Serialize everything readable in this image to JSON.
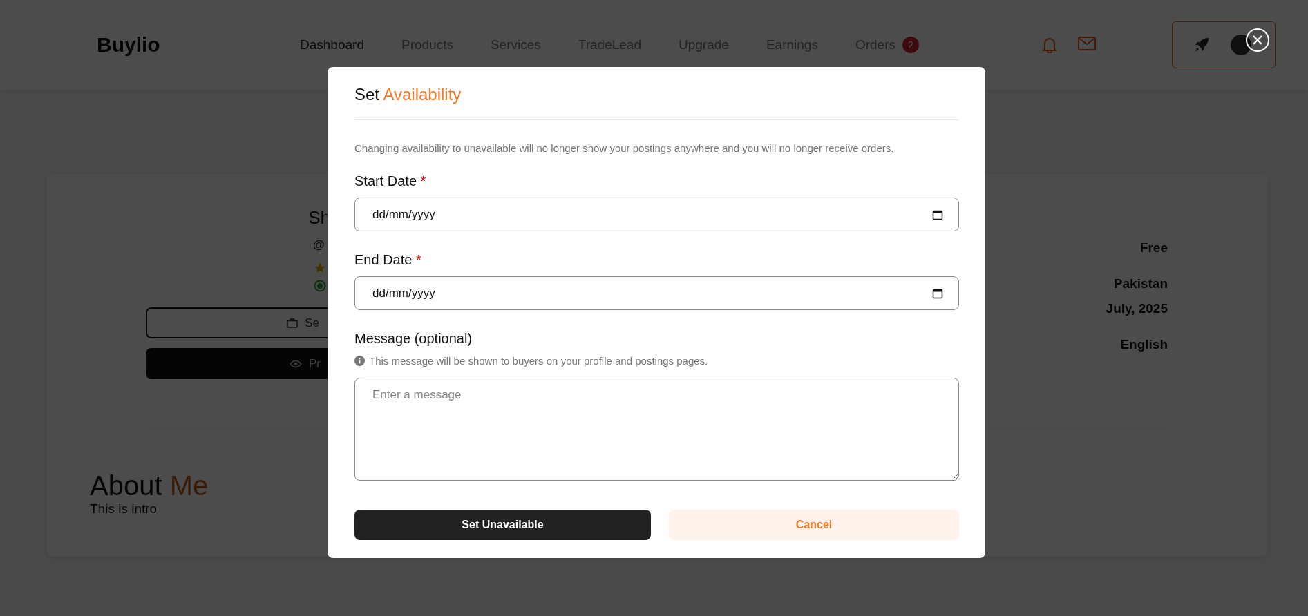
{
  "header": {
    "logo": "Buylio",
    "nav": [
      {
        "label": "Dashboard",
        "selected": true
      },
      {
        "label": "Products",
        "selected": false
      },
      {
        "label": "Services",
        "selected": false
      },
      {
        "label": "TradeLead",
        "selected": false
      },
      {
        "label": "Upgrade",
        "selected": false
      },
      {
        "label": "Earnings",
        "selected": false
      },
      {
        "label": "Orders",
        "selected": false,
        "badge": "2"
      }
    ]
  },
  "profile": {
    "name": "Sh",
    "handle": "@",
    "buttons": [
      {
        "label": "Se",
        "kind": "outline"
      },
      {
        "label": "Pr",
        "kind": "dark"
      }
    ]
  },
  "details": [
    "Free",
    "Pakistan",
    "July, 2025",
    "English"
  ],
  "about": {
    "title": "About",
    "title_accent": "Me",
    "text": "This is intro"
  },
  "modal": {
    "title": "Set",
    "title_accent": "Availability",
    "notice": "Changing availability to unavailable will no longer show your postings anywhere and you will no longer receive orders.",
    "fields": [
      {
        "label": "Start Date",
        "required_mark": "*",
        "placeholder": "dd/mm/yyyy"
      },
      {
        "label": "End Date",
        "required_mark": "*",
        "placeholder": "dd/mm/yyyy"
      }
    ],
    "message": {
      "label": "Message (optional)",
      "hint": "This message will be shown to buyers on your profile and postings pages.",
      "placeholder": "Enter a message"
    },
    "buttons": [
      {
        "label": "Set Unavailable",
        "kind": "primary"
      },
      {
        "label": "Cancel",
        "kind": "secondary"
      }
    ]
  }
}
